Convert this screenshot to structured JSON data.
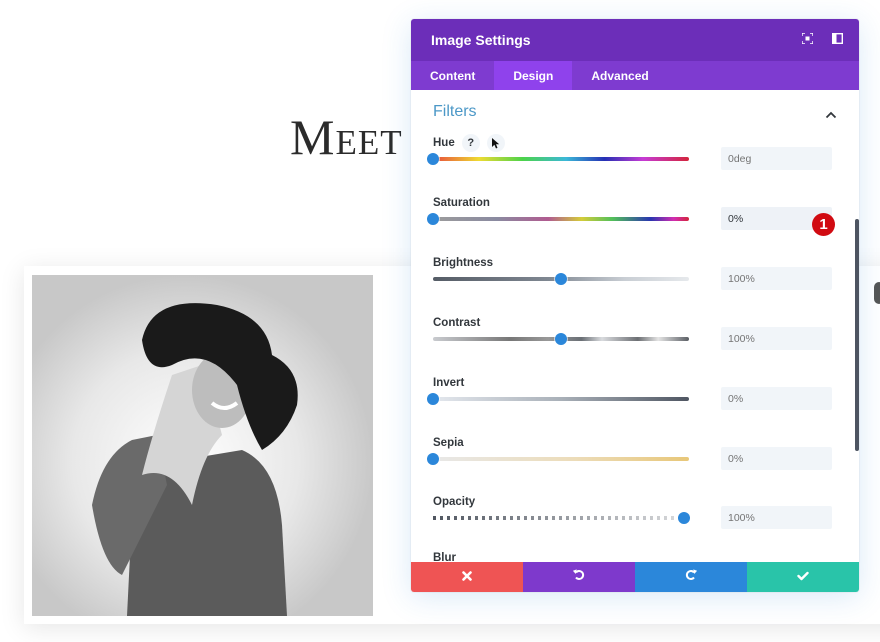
{
  "page": {
    "heading": "Meet"
  },
  "modal": {
    "title": "Image Settings",
    "header_icons": [
      "fullscreen-icon",
      "sidebar-icon"
    ],
    "tabs": [
      {
        "label": "Content",
        "active": false
      },
      {
        "label": "Design",
        "active": true
      },
      {
        "label": "Advanced",
        "active": false
      }
    ],
    "section": {
      "title": "Filters",
      "expanded": true
    },
    "filters": [
      {
        "label": "Hue",
        "value": "0deg",
        "placeholder": "0deg",
        "position": 0.0,
        "has_help": true
      },
      {
        "label": "Saturation",
        "value": "0%",
        "position": 0.0,
        "active": true
      },
      {
        "label": "Brightness",
        "value": "100%",
        "position": 0.5
      },
      {
        "label": "Contrast",
        "value": "100%",
        "position": 0.5
      },
      {
        "label": "Invert",
        "value": "0%",
        "position": 0.0
      },
      {
        "label": "Sepia",
        "value": "0%",
        "position": 0.0
      },
      {
        "label": "Opacity",
        "value": "100%",
        "position": 1.0
      }
    ],
    "next_filter_label": "Blur",
    "help_label": "?",
    "step_badge": "1",
    "footer": {
      "cancel": "cancel-icon",
      "undo": "undo-icon",
      "redo": "redo-icon",
      "save": "check-icon"
    }
  },
  "colors": {
    "header": "#6c2eb9",
    "tabs": "#7e3bd0",
    "tab_active": "#8f42ec",
    "accent": "#2b87da",
    "section_title": "#4c98c7",
    "badge": "#d10b12",
    "cancel": "#ef5454",
    "undo": "#7e39cc",
    "redo": "#2b87da",
    "save": "#29c4a9"
  }
}
